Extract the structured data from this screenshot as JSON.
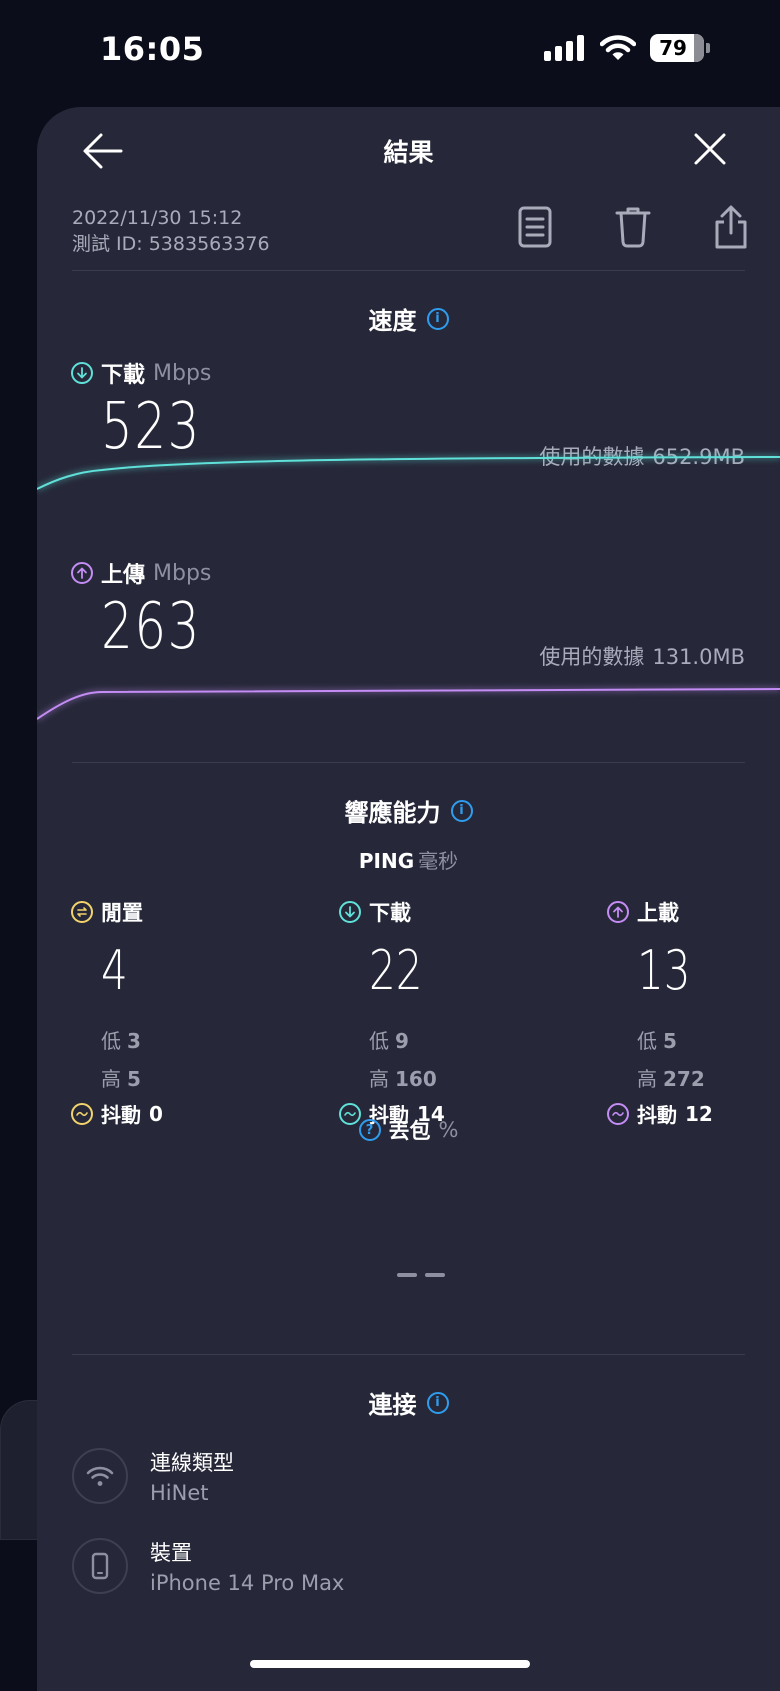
{
  "status": {
    "time": "16:05",
    "battery": "79"
  },
  "header": {
    "title": "結果"
  },
  "meta": {
    "datetime": "2022/11/30 15:12",
    "test_id": "測試 ID: 5383563376"
  },
  "speed": {
    "title": "速度",
    "download": {
      "label": "下載",
      "unit": "Mbps",
      "value": "523",
      "used_label": "使用的數據",
      "used_value": "652.9MB"
    },
    "upload": {
      "label": "上傳",
      "unit": "Mbps",
      "value": "263",
      "used_label": "使用的數據",
      "used_value": "131.0MB"
    }
  },
  "responsiveness": {
    "title": "響應能力",
    "ping_label": "PING",
    "ping_unit": "毫秒",
    "columns": [
      {
        "label": "閒置",
        "value": "4",
        "low_label": "低",
        "low": "3",
        "high_label": "高",
        "high": "5",
        "jitter_label": "抖動",
        "jitter": "0",
        "color": "#f3d36b"
      },
      {
        "label": "下載",
        "value": "22",
        "low_label": "低",
        "low": "9",
        "high_label": "高",
        "high": "160",
        "jitter_label": "抖動",
        "jitter": "14",
        "color": "#5fe0d8"
      },
      {
        "label": "上載",
        "value": "13",
        "low_label": "低",
        "low": "5",
        "high_label": "高",
        "high": "272",
        "jitter_label": "抖動",
        "jitter": "12",
        "color": "#c48cf5"
      }
    ]
  },
  "packet_loss": {
    "label": "丟包",
    "unit": "%"
  },
  "connection": {
    "title": "連接",
    "items": [
      {
        "key": "連線類型",
        "value": "HiNet",
        "icon": "wifi-icon"
      },
      {
        "key": "裝置",
        "value": "iPhone 14 Pro Max",
        "icon": "phone-icon"
      }
    ]
  },
  "colors": {
    "download": "#5fe0d8",
    "upload": "#c48cf5",
    "idle": "#f3d36b",
    "info": "#2f9dee",
    "background": "#262839"
  }
}
